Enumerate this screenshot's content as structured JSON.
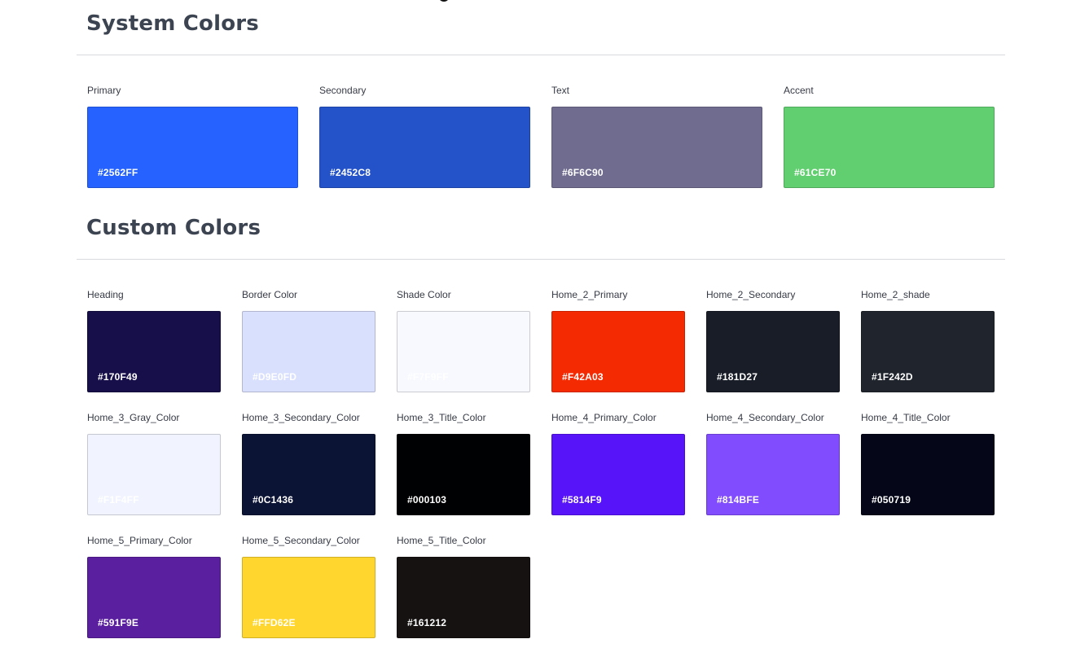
{
  "system": {
    "title": "System Colors",
    "colors": [
      {
        "name": "Primary",
        "code": "#2562FF",
        "hex": "#2562FF"
      },
      {
        "name": "Secondary",
        "code": "#2452C8",
        "hex": "#2452C8"
      },
      {
        "name": "Text",
        "code": "#6F6C90",
        "hex": "#6F6C90"
      },
      {
        "name": "Accent",
        "code": "#61CE70",
        "hex": "#61CE70"
      }
    ]
  },
  "custom": {
    "title": "Custom Colors",
    "colors": [
      {
        "name": "Heading",
        "code": "#170F49",
        "hex": "#170F49"
      },
      {
        "name": "Border Color",
        "code": "#D9E0FD",
        "hex": "#D9E0FD"
      },
      {
        "name": "Shade Color",
        "code": "#F7F9FF",
        "hex": "#F7F9FF"
      },
      {
        "name": "Home_2_Primary",
        "code": "#F42A03",
        "hex": "#F42A03"
      },
      {
        "name": "Home_2_Secondary",
        "code": "#181D27",
        "hex": "#181D27"
      },
      {
        "name": "Home_2_shade",
        "code": "#1F242D",
        "hex": "#1F242D"
      },
      {
        "name": "Home_3_Gray_Color",
        "code": "#F1F4FF",
        "hex": "#F1F4FF"
      },
      {
        "name": "Home_3_Secondary_Color",
        "code": "#0C1436",
        "hex": "#0C1436"
      },
      {
        "name": "Home_3_Title_Color",
        "code": "#000103",
        "hex": "#000103"
      },
      {
        "name": "Home_4_Primary_Color",
        "code": "#5814F9",
        "hex": "#5814F9"
      },
      {
        "name": "Home_4_Secondary_Color",
        "code": "#814BFE",
        "hex": "#814BFE"
      },
      {
        "name": "Home_4_Title_Color",
        "code": "#050719",
        "hex": "#050719"
      },
      {
        "name": "Home_5_Primary_Color",
        "code": "#591F9E",
        "hex": "#591F9E"
      },
      {
        "name": "Home_5_Secondary_Color",
        "code": "#FFD62E",
        "hex": "#FFD62E"
      },
      {
        "name": "Home_5_Title_Color",
        "code": "#161212",
        "hex": "#161212"
      }
    ]
  }
}
